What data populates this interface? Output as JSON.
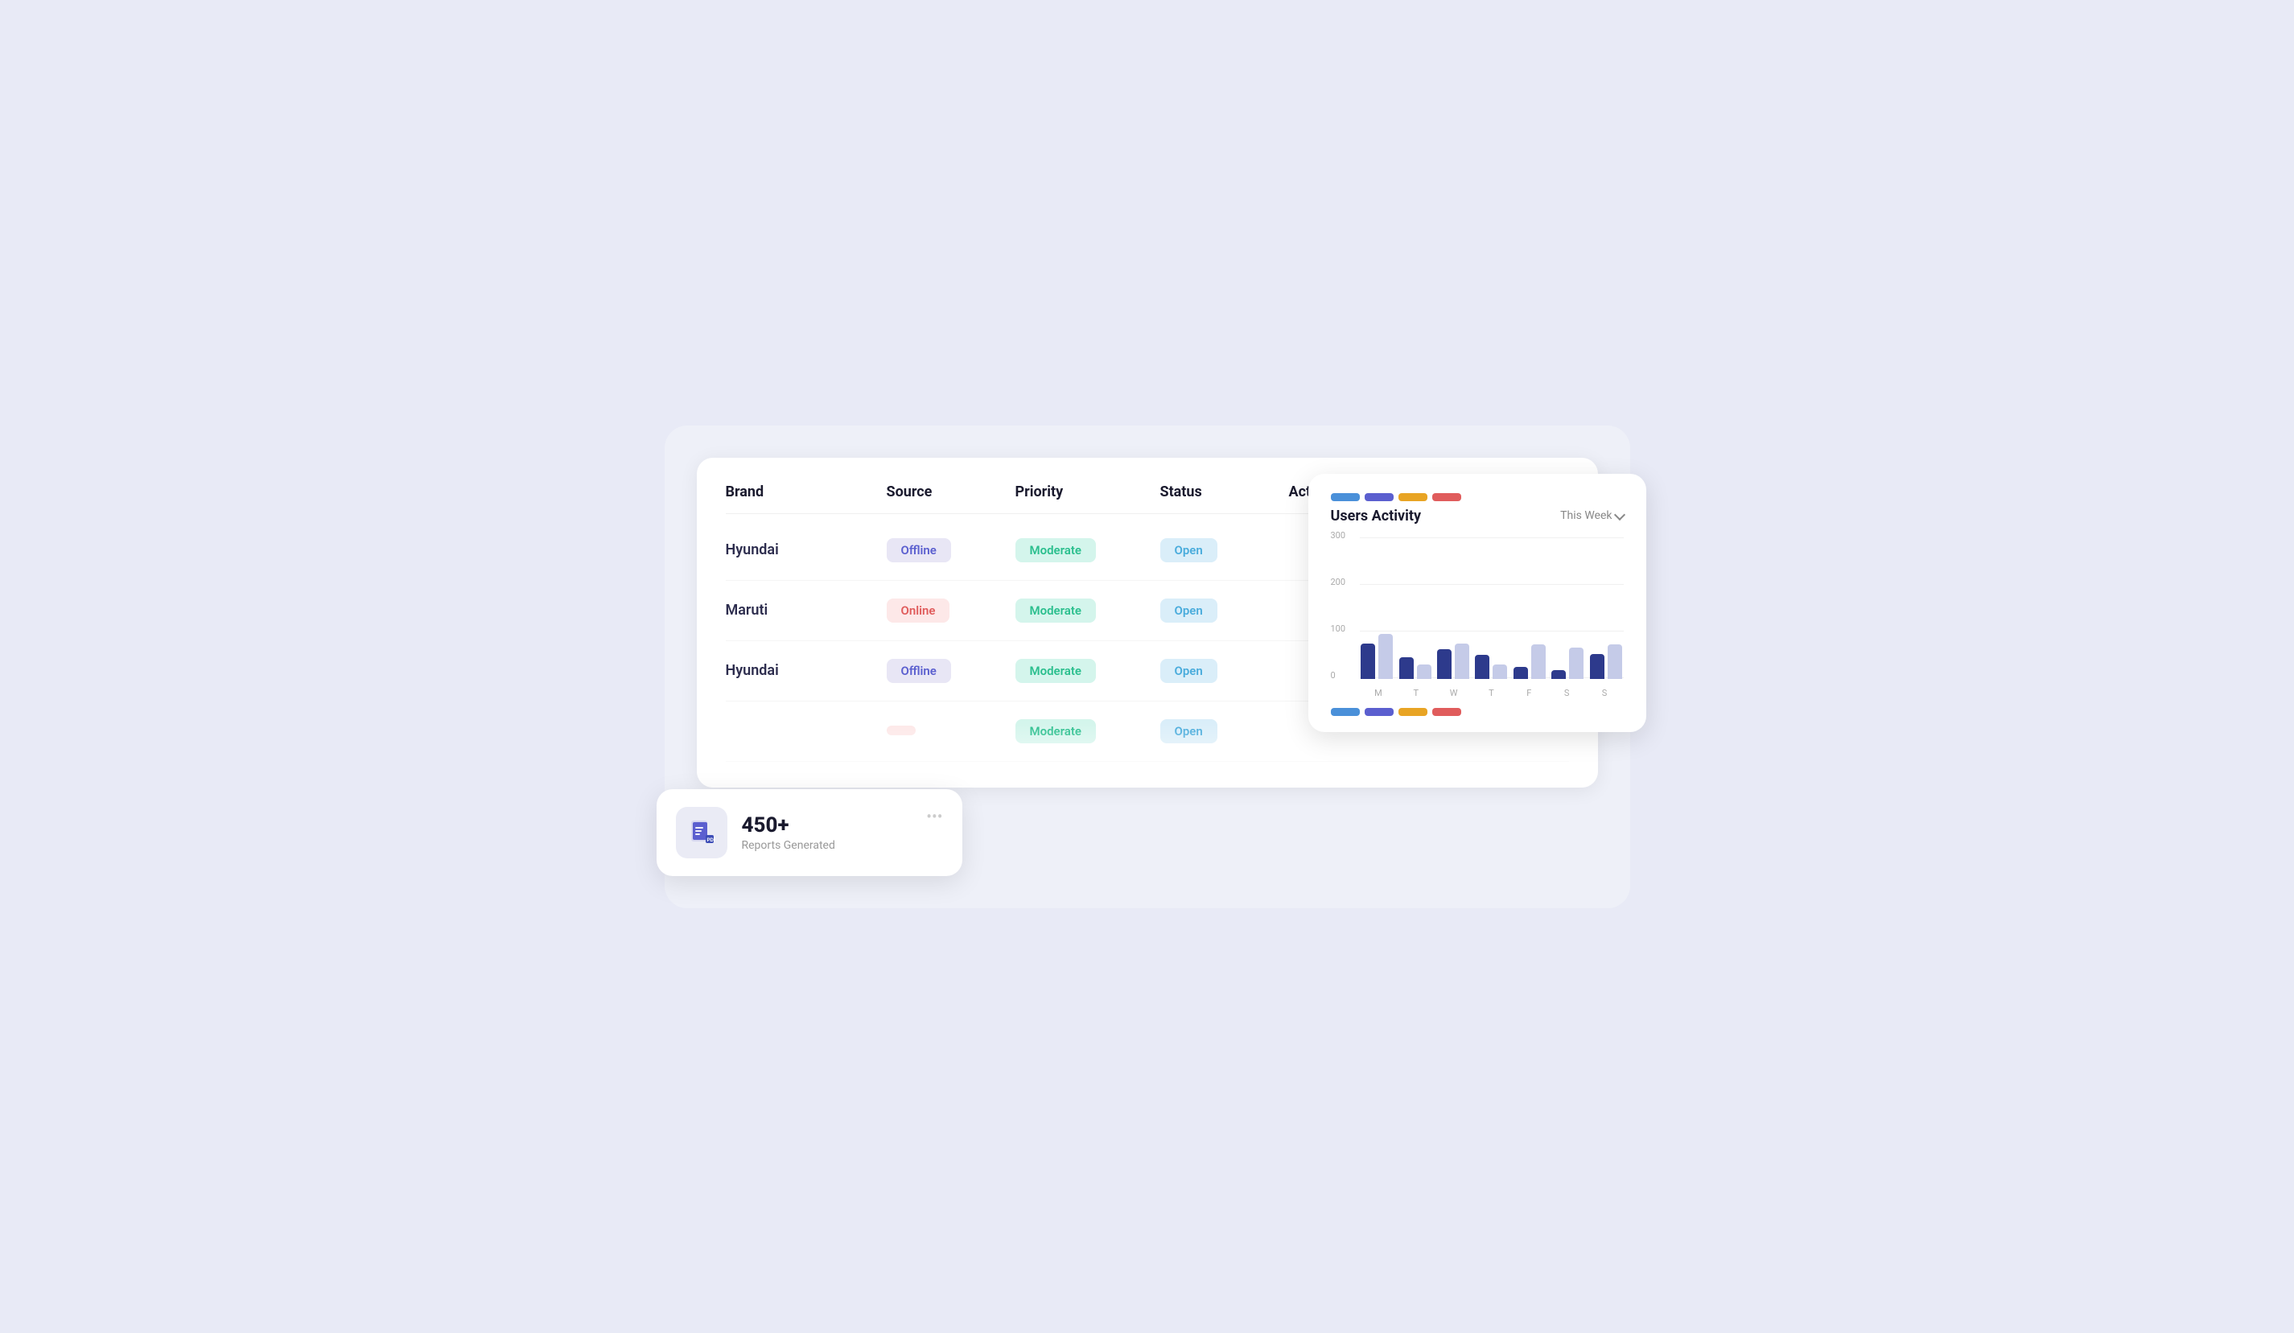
{
  "table": {
    "headers": [
      "Brand",
      "Source",
      "Priority",
      "Status",
      "Action"
    ],
    "rows": [
      {
        "brand": "Hyundai",
        "source": "Offline",
        "source_type": "offline",
        "priority": "Moderate",
        "status": "Open"
      },
      {
        "brand": "Maruti",
        "source": "Online",
        "source_type": "online",
        "priority": "Moderate",
        "status": "Open"
      },
      {
        "brand": "Hyundai",
        "source": "Offline",
        "source_type": "offline",
        "priority": "Moderate",
        "status": "Open"
      },
      {
        "brand": "",
        "source": "",
        "source_type": "",
        "priority": "Moderate",
        "status": "Open"
      }
    ]
  },
  "activity": {
    "title": "Users Activity",
    "week_selector": "This Week",
    "y_labels": [
      "300",
      "200",
      "100",
      "0"
    ],
    "days": [
      "M",
      "T",
      "W",
      "T",
      "F",
      "S",
      "S"
    ],
    "bars": [
      {
        "dark": 75,
        "light": 95
      },
      {
        "dark": 45,
        "light": 30
      },
      {
        "dark": 62,
        "light": 75
      },
      {
        "dark": 50,
        "light": 30
      },
      {
        "dark": 25,
        "light": 72
      },
      {
        "dark": 18,
        "light": 65
      },
      {
        "dark": 52,
        "light": 72
      }
    ],
    "legend": [
      {
        "color": "#4a90d9"
      },
      {
        "color": "#5b5fcf"
      },
      {
        "color": "#e8a424"
      },
      {
        "color": "#e05c5c"
      }
    ]
  },
  "reports": {
    "count": "450+",
    "label": "Reports Generated",
    "menu_label": "•••"
  }
}
